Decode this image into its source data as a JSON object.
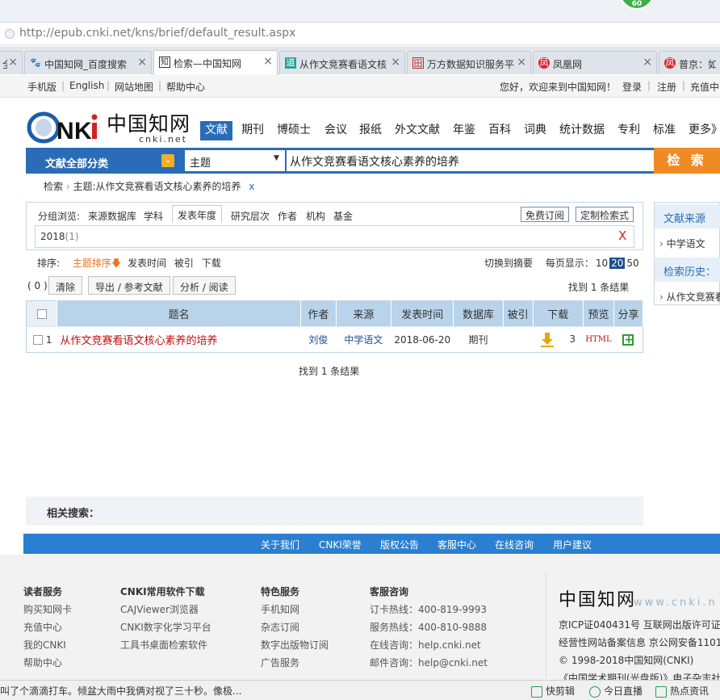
{
  "browser": {
    "badge": "60",
    "address": "http://epub.cnki.net/kns/brief/default_result.aspx",
    "tabs": [
      {
        "label": "全",
        "icon": ""
      },
      {
        "label": "中国知网_百度搜索",
        "icon": "🐾"
      },
      {
        "label": "检索—中国知网",
        "icon": "知"
      },
      {
        "label": "从作文竞赛看语文核",
        "icon": "道"
      },
      {
        "label": "万方数据知识服务平",
        "icon": "田"
      },
      {
        "label": "凤凰网",
        "icon": "凤"
      },
      {
        "label": "普京：如",
        "icon": "凤"
      }
    ]
  },
  "toplinks": {
    "mobile": "手机版",
    "english": "English",
    "sitemap": "网站地图",
    "help": "帮助中心",
    "welcome": "您好，欢迎来到中国知网！",
    "login": "登录",
    "register": "注册",
    "recharge": "充值中"
  },
  "logo": {
    "cn": "中国知网",
    "domain": "cnki.net"
  },
  "nav": [
    "文献",
    "期刊",
    "博硕士",
    "会议",
    "报纸",
    "外文文献",
    "年鉴",
    "百科",
    "词典",
    "统计数据",
    "专利",
    "标准",
    "更多》"
  ],
  "search": {
    "category": "文献全部分类",
    "field": "主题",
    "query": "从作文竞赛看语文核心素养的培养",
    "button": "检 索"
  },
  "breadcrumb": {
    "root": "检索",
    "item": "主题:从作文竞赛看语文核心素养的培养",
    "close": "x"
  },
  "group": {
    "label": "分组浏览:",
    "items": [
      "来源数据库",
      "学科",
      "发表年度",
      "研究层次",
      "作者",
      "机构",
      "基金"
    ],
    "subscribe": "免费订阅",
    "custom": "定制检索式",
    "filter_value": "2018",
    "filter_count": "(1)",
    "filter_close": "X"
  },
  "sort": {
    "label": "排序:",
    "options": [
      "主题排序",
      "发表时间",
      "被引",
      "下载"
    ],
    "toggle_abstract": "切换到摘要",
    "per_page_label": "每页显示：",
    "per_page": [
      "10",
      "20",
      "50"
    ],
    "per_page_selected": "20"
  },
  "actions": {
    "count": "( 0 )",
    "clear": "清除",
    "export": "导出 / 参考文献",
    "analyze": "分析 / 阅读",
    "found": "找到 1 条结果"
  },
  "table": {
    "headers": [
      "题名",
      "作者",
      "来源",
      "发表时间",
      "数据库",
      "被引",
      "下载",
      "预览",
      "分享"
    ],
    "rows": [
      {
        "num": "1",
        "title": "从作文竞赛看语文核心素养的培养",
        "author": "刘俊",
        "source": "中学语文",
        "date": "2018-06-20",
        "db": "期刊",
        "cited": "",
        "downloads": "3",
        "preview": "HTML"
      }
    ]
  },
  "found_bottom": "找到 1 条结果",
  "right_panel": {
    "source_title": "文献来源",
    "source_item": "中学语文",
    "history_title": "检索历史：",
    "history_item": "从作文竞赛看"
  },
  "related": {
    "label": "相关搜索："
  },
  "footer_bar": [
    "关于我们",
    "CNKI荣誉",
    "版权公告",
    "客服中心",
    "在线咨询",
    "用户建议"
  ],
  "footer": {
    "col1": {
      "title": "读者服务",
      "items": [
        "购买知网卡",
        "充值中心",
        "我的CNKI",
        "帮助中心"
      ]
    },
    "col2": {
      "title": "CNKI常用软件下载",
      "items": [
        "CAJViewer浏览器",
        "CNKI数字化学习平台",
        "工具书桌面检索软件"
      ]
    },
    "col3": {
      "title": "特色服务",
      "items": [
        "手机知网",
        "杂志订阅",
        "数字出版物订阅",
        "广告服务"
      ]
    },
    "col4": {
      "title": "客服咨询",
      "items": [
        "订卡热线：400-819-9993",
        "服务热线：400-810-9888",
        "在线咨询：help.cnki.net",
        "邮件咨询：help@cnki.net"
      ]
    },
    "brand_cn": "中国知网",
    "brand_web": "www.cnki.n",
    "icp1": "京ICP证040431号 互联网出版许可证",
    "icp2": "经营性网站备案信息 京公网安备11010",
    "copyright": "© 1998-2018中国知网(CNKI)",
    "journal": "《中国学术期刊(光盘版)》电子杂志社"
  },
  "statusbar": {
    "news": "叫了个滴滴打车。倾盆大雨中我俩对视了三十秒。像极...",
    "clip": "快剪辑",
    "live": "今日直播",
    "hot": "热点资讯"
  }
}
